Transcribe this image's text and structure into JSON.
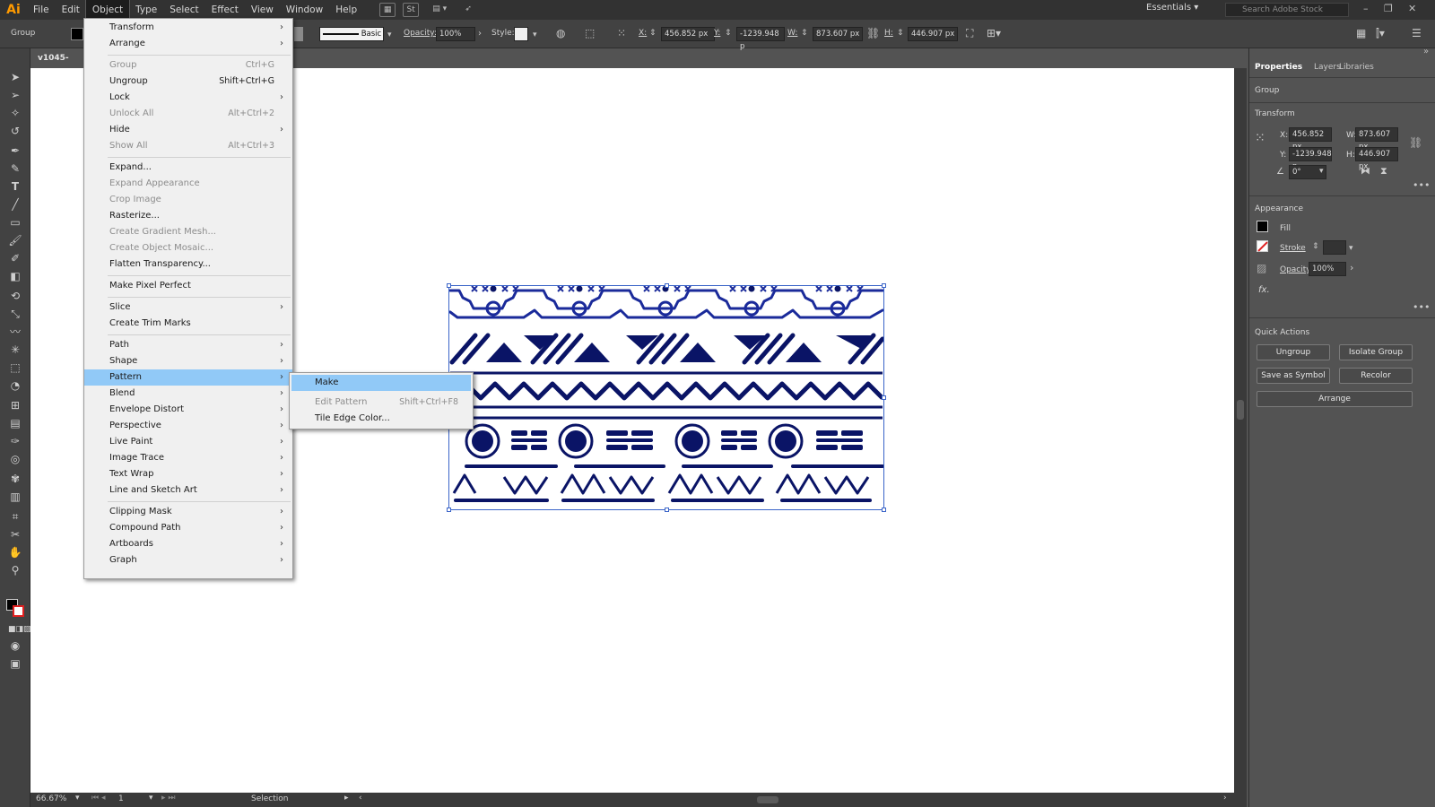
{
  "app": {
    "logo": "Ai"
  },
  "menubar": {
    "items": [
      "File",
      "Edit",
      "Object",
      "Type",
      "Select",
      "Effect",
      "View",
      "Window",
      "Help"
    ],
    "active": "Object",
    "workspace": "Essentials",
    "search_placeholder": "Search Adobe Stock"
  },
  "controlbar": {
    "selection_label": "Group",
    "stroke_profile": "Basic",
    "opacity_label": "Opacity:",
    "opacity_value": "100%",
    "style_label": "Style:",
    "x_label": "X:",
    "x_value": "456.852 px",
    "y_label": "Y:",
    "y_value": "-1239.948 p",
    "w_label": "W:",
    "w_value": "873.607 px",
    "h_label": "H:",
    "h_value": "446.907 px"
  },
  "document": {
    "tab_title": "v1045-41b.e",
    "zoom": "66.67%",
    "artboard_number": "1",
    "status_tool": "Selection"
  },
  "object_menu": {
    "items": [
      {
        "label": "Transform",
        "shortcut": "",
        "submenu": true,
        "disabled": false
      },
      {
        "label": "Arrange",
        "shortcut": "",
        "submenu": true,
        "disabled": false
      },
      {
        "label": "Group",
        "shortcut": "Ctrl+G",
        "submenu": false,
        "disabled": true
      },
      {
        "label": "Ungroup",
        "shortcut": "Shift+Ctrl+G",
        "submenu": false,
        "disabled": false
      },
      {
        "label": "Lock",
        "shortcut": "",
        "submenu": true,
        "disabled": false
      },
      {
        "label": "Unlock All",
        "shortcut": "Alt+Ctrl+2",
        "submenu": false,
        "disabled": true
      },
      {
        "label": "Hide",
        "shortcut": "",
        "submenu": true,
        "disabled": false
      },
      {
        "label": "Show All",
        "shortcut": "Alt+Ctrl+3",
        "submenu": false,
        "disabled": true
      },
      {
        "label": "Expand...",
        "shortcut": "",
        "submenu": false,
        "disabled": false
      },
      {
        "label": "Expand Appearance",
        "shortcut": "",
        "submenu": false,
        "disabled": true
      },
      {
        "label": "Crop Image",
        "shortcut": "",
        "submenu": false,
        "disabled": true
      },
      {
        "label": "Rasterize...",
        "shortcut": "",
        "submenu": false,
        "disabled": false
      },
      {
        "label": "Create Gradient Mesh...",
        "shortcut": "",
        "submenu": false,
        "disabled": true
      },
      {
        "label": "Create Object Mosaic...",
        "shortcut": "",
        "submenu": false,
        "disabled": true
      },
      {
        "label": "Flatten Transparency...",
        "shortcut": "",
        "submenu": false,
        "disabled": false
      },
      {
        "label": "Make Pixel Perfect",
        "shortcut": "",
        "submenu": false,
        "disabled": false
      },
      {
        "label": "Slice",
        "shortcut": "",
        "submenu": true,
        "disabled": false
      },
      {
        "label": "Create Trim Marks",
        "shortcut": "",
        "submenu": false,
        "disabled": false
      },
      {
        "label": "Path",
        "shortcut": "",
        "submenu": true,
        "disabled": false
      },
      {
        "label": "Shape",
        "shortcut": "",
        "submenu": true,
        "disabled": false
      },
      {
        "label": "Pattern",
        "shortcut": "",
        "submenu": true,
        "disabled": false
      },
      {
        "label": "Blend",
        "shortcut": "",
        "submenu": true,
        "disabled": false
      },
      {
        "label": "Envelope Distort",
        "shortcut": "",
        "submenu": true,
        "disabled": false
      },
      {
        "label": "Perspective",
        "shortcut": "",
        "submenu": true,
        "disabled": false
      },
      {
        "label": "Live Paint",
        "shortcut": "",
        "submenu": true,
        "disabled": false
      },
      {
        "label": "Image Trace",
        "shortcut": "",
        "submenu": true,
        "disabled": false
      },
      {
        "label": "Text Wrap",
        "shortcut": "",
        "submenu": true,
        "disabled": false
      },
      {
        "label": "Line and Sketch Art",
        "shortcut": "",
        "submenu": true,
        "disabled": false
      },
      {
        "label": "Clipping Mask",
        "shortcut": "",
        "submenu": true,
        "disabled": false
      },
      {
        "label": "Compound Path",
        "shortcut": "",
        "submenu": true,
        "disabled": false
      },
      {
        "label": "Artboards",
        "shortcut": "",
        "submenu": true,
        "disabled": false
      },
      {
        "label": "Graph",
        "shortcut": "",
        "submenu": true,
        "disabled": false
      }
    ],
    "highlighted": "Pattern"
  },
  "pattern_submenu": {
    "items": [
      {
        "label": "Make",
        "shortcut": "",
        "disabled": false
      },
      {
        "label": "Edit Pattern",
        "shortcut": "Shift+Ctrl+F8",
        "disabled": true
      },
      {
        "label": "Tile Edge Color...",
        "shortcut": "",
        "disabled": false
      }
    ],
    "highlighted": "Make"
  },
  "properties_panel": {
    "tabs": [
      "Properties",
      "Layers",
      "Libraries"
    ],
    "active_tab": "Properties",
    "selection_type": "Group",
    "transform_title": "Transform",
    "x_label": "X:",
    "x_value": "456.852 px",
    "y_label": "Y:",
    "y_value": "-1239.948 p",
    "w_label": "W:",
    "w_value": "873.607 px",
    "h_label": "H:",
    "h_value": "446.907 px",
    "angle_value": "0°",
    "appearance_title": "Appearance",
    "fill_label": "Fill",
    "stroke_label": "Stroke",
    "opacity_label": "Opacity",
    "opacity_value": "100%",
    "fx_label": "fx.",
    "quick_actions_title": "Quick Actions",
    "buttons": {
      "ungroup": "Ungroup",
      "isolate_group": "Isolate Group",
      "save_as_symbol": "Save as Symbol",
      "recolor": "Recolor",
      "arrange": "Arrange"
    }
  },
  "colors": {
    "menu_highlight": "#91c9f7",
    "artwork_blue": "#1a2a9a",
    "logo_orange": "#ff9a00"
  }
}
